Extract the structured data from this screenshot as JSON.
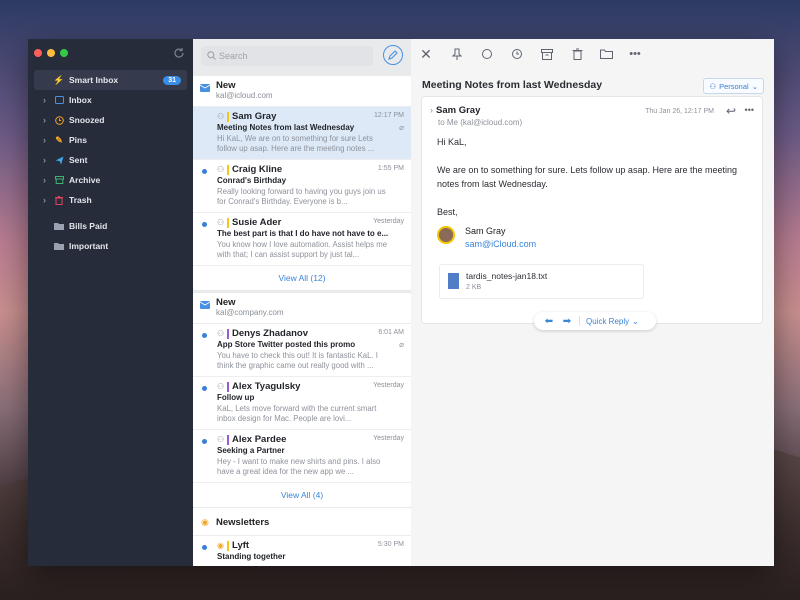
{
  "sidebar": {
    "items": [
      {
        "label": "Smart Inbox",
        "badge": "31",
        "icon": "lightning-icon",
        "color": "#4a90e2"
      },
      {
        "label": "Inbox",
        "icon": "inbox-icon",
        "color": "#4a90e2"
      },
      {
        "label": "Snoozed",
        "icon": "clock-icon",
        "color": "#f5a623"
      },
      {
        "label": "Pins",
        "icon": "pin-icon",
        "color": "#f5a623"
      },
      {
        "label": "Sent",
        "icon": "paper-plane-icon",
        "color": "#3fa9e8"
      },
      {
        "label": "Archive",
        "icon": "archive-icon",
        "color": "#3cb371"
      },
      {
        "label": "Trash",
        "icon": "trash-icon",
        "color": "#e0465a"
      },
      {
        "label": "Bills Paid",
        "icon": "folder-icon",
        "color": "#9aa1b1"
      },
      {
        "label": "Important",
        "icon": "folder-icon",
        "color": "#9aa1b1"
      }
    ]
  },
  "search": {
    "placeholder": "Search"
  },
  "groups": [
    {
      "name": "New",
      "email": "kal@icloud.com",
      "view_all": "View All (12)",
      "messages": [
        {
          "sender": "Sam Gray",
          "time": "12:17 PM",
          "subject": "Meeting Notes from last Wednesday",
          "preview": "Hi KaL, We are on to something for sure Lets follow up asap. Here are the meeting notes ...",
          "bar_color": "#f5c518"
        },
        {
          "sender": "Craig Kline",
          "time": "1:55 PM",
          "subject": "Conrad's Birthday",
          "preview": "Really looking forward to having you guys join us for Conrad's Birthday. Everyone is b...",
          "bar_color": "#f5c518"
        },
        {
          "sender": "Susie Ader",
          "time": "Yesterday",
          "subject": "The best part is that I do have not have to e...",
          "preview": "You know how I love automation. Assist helps me with that; I can assist support by just tal...",
          "bar_color": "#f5c518"
        }
      ]
    },
    {
      "name": "New",
      "email": "kal@company.com",
      "view_all": "View All (4)",
      "messages": [
        {
          "sender": "Denys Zhadanov",
          "time": "6:01 AM",
          "subject": "App Store Twitter posted this promo",
          "preview": "You have to check this out! It is fantastic KaL. I think the graphic came out really good with ...",
          "bar_color": "#9b59d6"
        },
        {
          "sender": "Alex Tyagulsky",
          "time": "Yesterday",
          "subject": "Follow up",
          "preview": "KaL, Lets move forward with the current smart inbox design for Mac. People are lovi...",
          "bar_color": "#9b59d6"
        },
        {
          "sender": "Alex Pardee",
          "time": "Yesterday",
          "subject": "Seeking a Partner",
          "preview": "Hey - I want to make new shirts and pins. I also have a great idea for the new app we ...",
          "bar_color": "#9b59d6"
        }
      ]
    }
  ],
  "newsletters": {
    "title": "Newsletters",
    "message": {
      "sender": "Lyft",
      "time": "5:30 PM",
      "subject": "Standing together",
      "bar_color": "#f5c518"
    }
  },
  "reader": {
    "title": "Meeting Notes from last Wednesday",
    "account_tag": "Personal",
    "from": "Sam Gray",
    "to": "to Me (kal@icloud.com)",
    "date": "Thu Jan 26, 12:17 PM",
    "greeting": "Hi KaL,",
    "body": "We are on to something for sure. Lets follow up asap. Here are the meeting notes from last Wednesday.",
    "closing": "Best,",
    "sig_name": "Sam Gray",
    "sig_email": "sam@iCloud.com",
    "attachment": {
      "name": "tardis_notes-jan18.txt",
      "size": "2 KB"
    },
    "quick_reply": "Quick Reply"
  }
}
